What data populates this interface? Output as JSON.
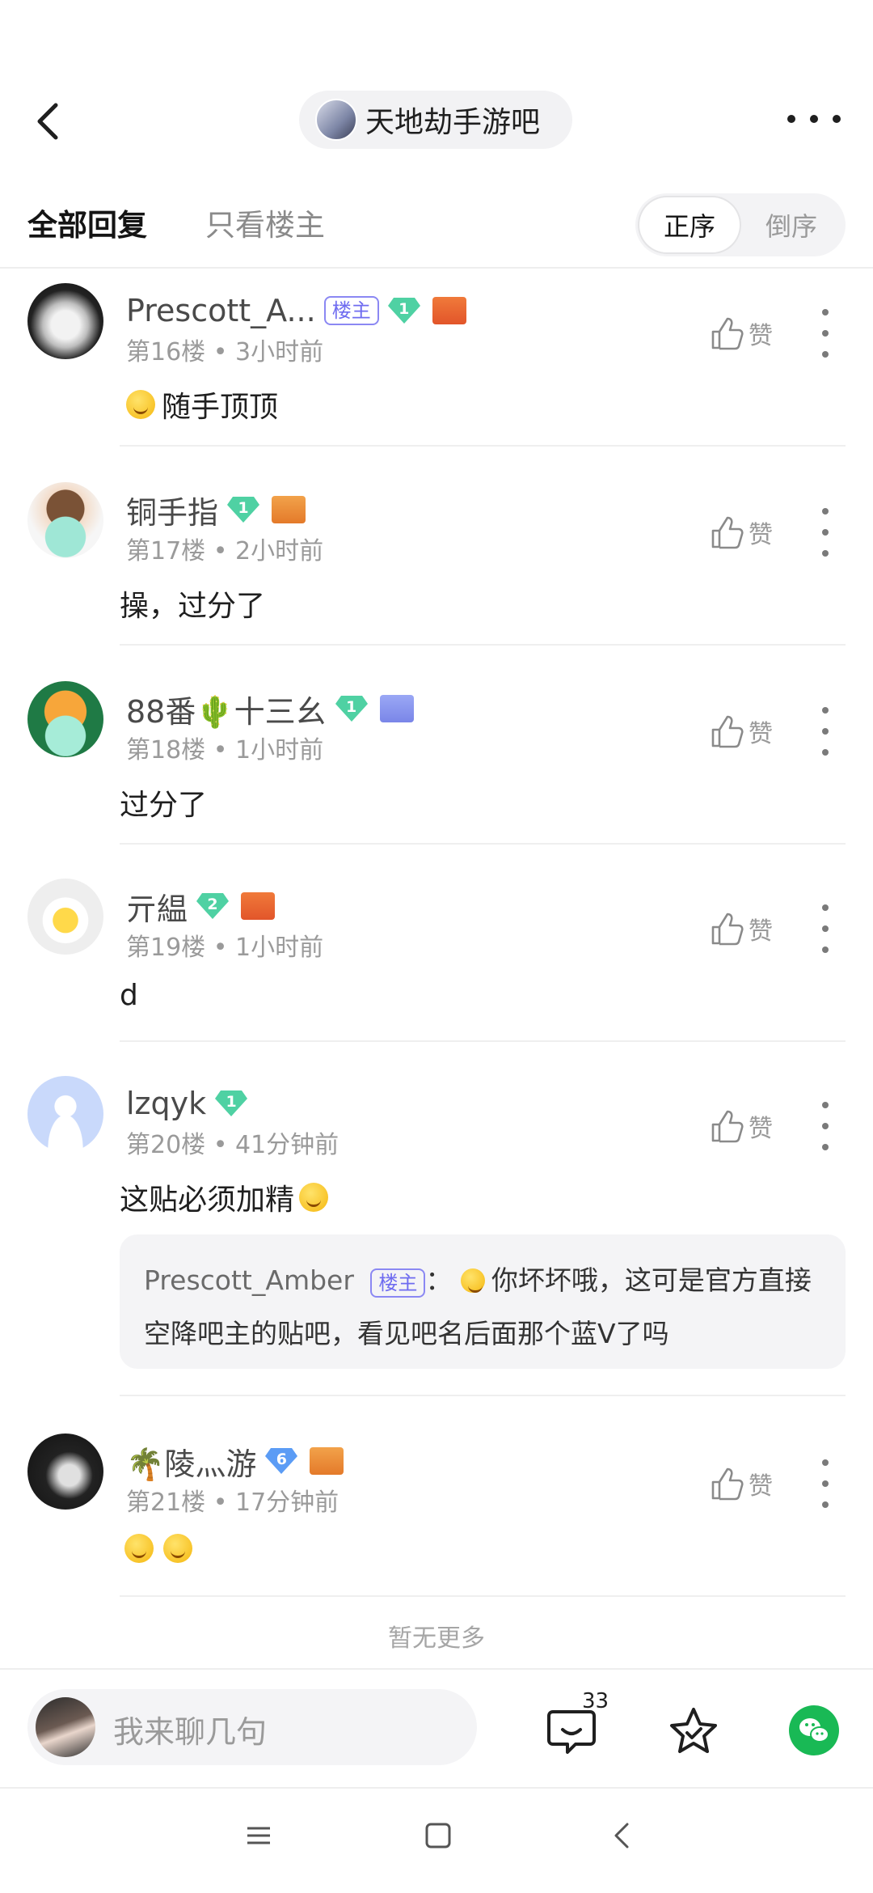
{
  "header": {
    "forum_title": "天地劫手游吧"
  },
  "tabs": {
    "all_replies": "全部回复",
    "only_op": "只看楼主",
    "order_asc": "正序",
    "order_desc": "倒序"
  },
  "posts": [
    {
      "username": "Prescott_A...",
      "owner_tag": "楼主",
      "level": "1",
      "floor": "第16楼",
      "time": "3小时前",
      "like_label": "赞",
      "content": "随手顶顶"
    },
    {
      "username": "铜手指",
      "level": "1",
      "floor": "第17楼",
      "time": "2小时前",
      "like_label": "赞",
      "content": "操，过分了"
    },
    {
      "username": "88番🌵十三幺",
      "level": "1",
      "floor": "第18楼",
      "time": "1小时前",
      "like_label": "赞",
      "content": "过分了"
    },
    {
      "username": "亓緼",
      "level": "2",
      "floor": "第19楼",
      "time": "1小时前",
      "like_label": "赞",
      "content": "d"
    },
    {
      "username": "lzqyk",
      "level": "1",
      "floor": "第20楼",
      "time": "41分钟前",
      "like_label": "赞",
      "content": "这贴必须加精",
      "quote": {
        "username": "Prescott_Amber",
        "owner_tag": "楼主",
        "separator": "：",
        "text": "你坏坏哦，这可是官方直接空降吧主的贴吧，看见吧名后面那个蓝V了吗"
      }
    },
    {
      "username": "🌴陵灬游",
      "level": "6",
      "floor": "第21楼",
      "time": "17分钟前",
      "like_label": "赞",
      "content": ""
    }
  ],
  "meta_separator": "•",
  "no_more": "暂无更多",
  "bottom_bar": {
    "input_placeholder": "我来聊几句",
    "comment_count": "33"
  },
  "colors": {
    "level_green": "#4fd1a3",
    "level_blue": "#5b9cf5",
    "owner_tag": "#6f6cf0",
    "wechat": "#19b955"
  }
}
